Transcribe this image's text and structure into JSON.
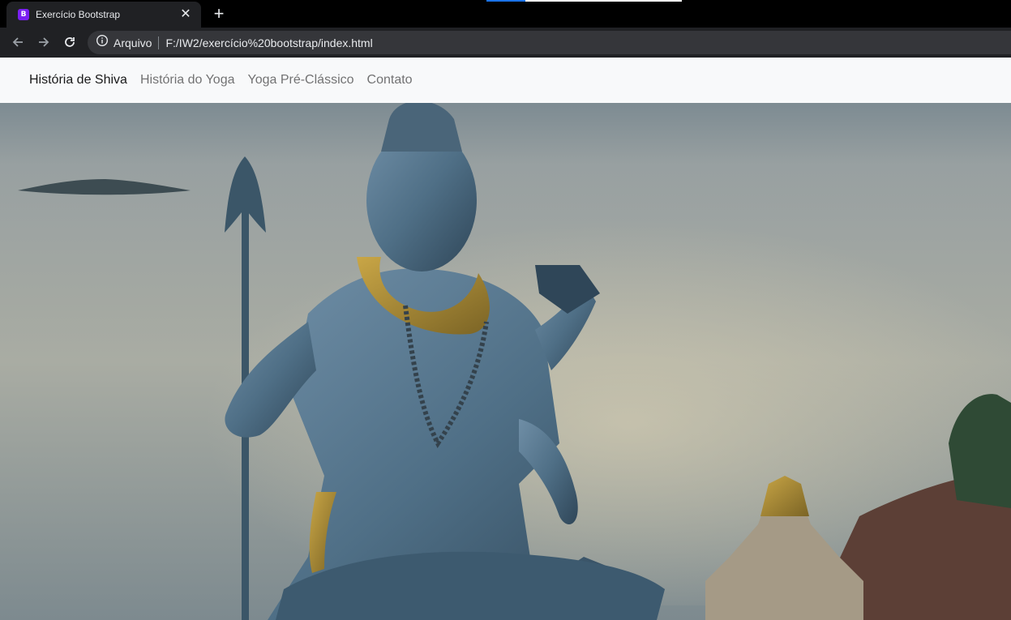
{
  "browser": {
    "tab_title": "Exercício Bootstrap",
    "favicon_letter": "B",
    "site_info_label": "Arquivo",
    "url": "F:/IW2/exercício%20bootstrap/index.html"
  },
  "navbar": {
    "links": [
      {
        "label": "História de Shiva",
        "active": true
      },
      {
        "label": "História do Yoga",
        "active": false
      },
      {
        "label": "Yoga Pré-Clássico",
        "active": false
      },
      {
        "label": "Contato",
        "active": false
      }
    ]
  },
  "colors": {
    "navbar_bg": "#f8f9fa",
    "favicon_bg": "#7a1ff2",
    "statue": "#4f6f86",
    "sea": "#8c9597"
  },
  "hero": {
    "image": "shiva-statue-by-the-sea"
  }
}
